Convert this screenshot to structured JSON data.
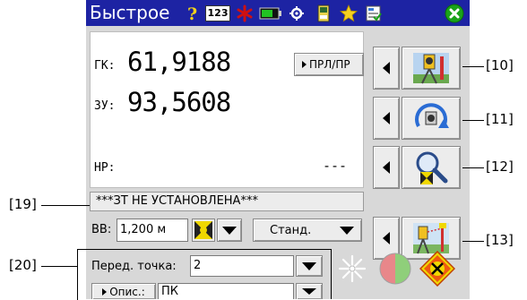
{
  "titlebar": {
    "title": "Быстрое",
    "icons": [
      "help-icon",
      "keypad-123-icon",
      "laser-asterisk-icon",
      "battery-icon",
      "settings-gear-icon",
      "memory-card-icon",
      "favorites-star-icon",
      "checklist-icon",
      "close-icon"
    ],
    "icon_123_label": "123"
  },
  "display": {
    "gk_label": "ГК:",
    "gk_value": "61,9188",
    "zu_label": "ЗУ:",
    "zu_value": "93,5608",
    "nr_label": "НР:",
    "nr_value": "---",
    "mode_button_label": "ПРЛ/ПР"
  },
  "status_message": "***ЗТ НЕ УСТАНОВЛЕНА***",
  "vv": {
    "label": "ВВ:",
    "value": "1,200 м",
    "prism_label": "Станд."
  },
  "fields": {
    "front_point_label": "Перед. точка:",
    "front_point_value": "2",
    "description_button_label": "Опис.:",
    "description_value": "ПК"
  },
  "callouts": {
    "c10": "[10]",
    "c11": "[11]",
    "c12": "[12]",
    "c13": "[13]",
    "c19": "[19]",
    "c20": "[20]"
  },
  "colors": {
    "titlebar_bg": "#1d23a3",
    "panel_bg": "#d8d8d8",
    "laser_red": "#d01010",
    "close_green": "#1aa31a"
  },
  "side_buttons": [
    "instrument-setup-icon",
    "rotate-instrument-icon",
    "search-target-icon",
    "stakeout-icon"
  ]
}
